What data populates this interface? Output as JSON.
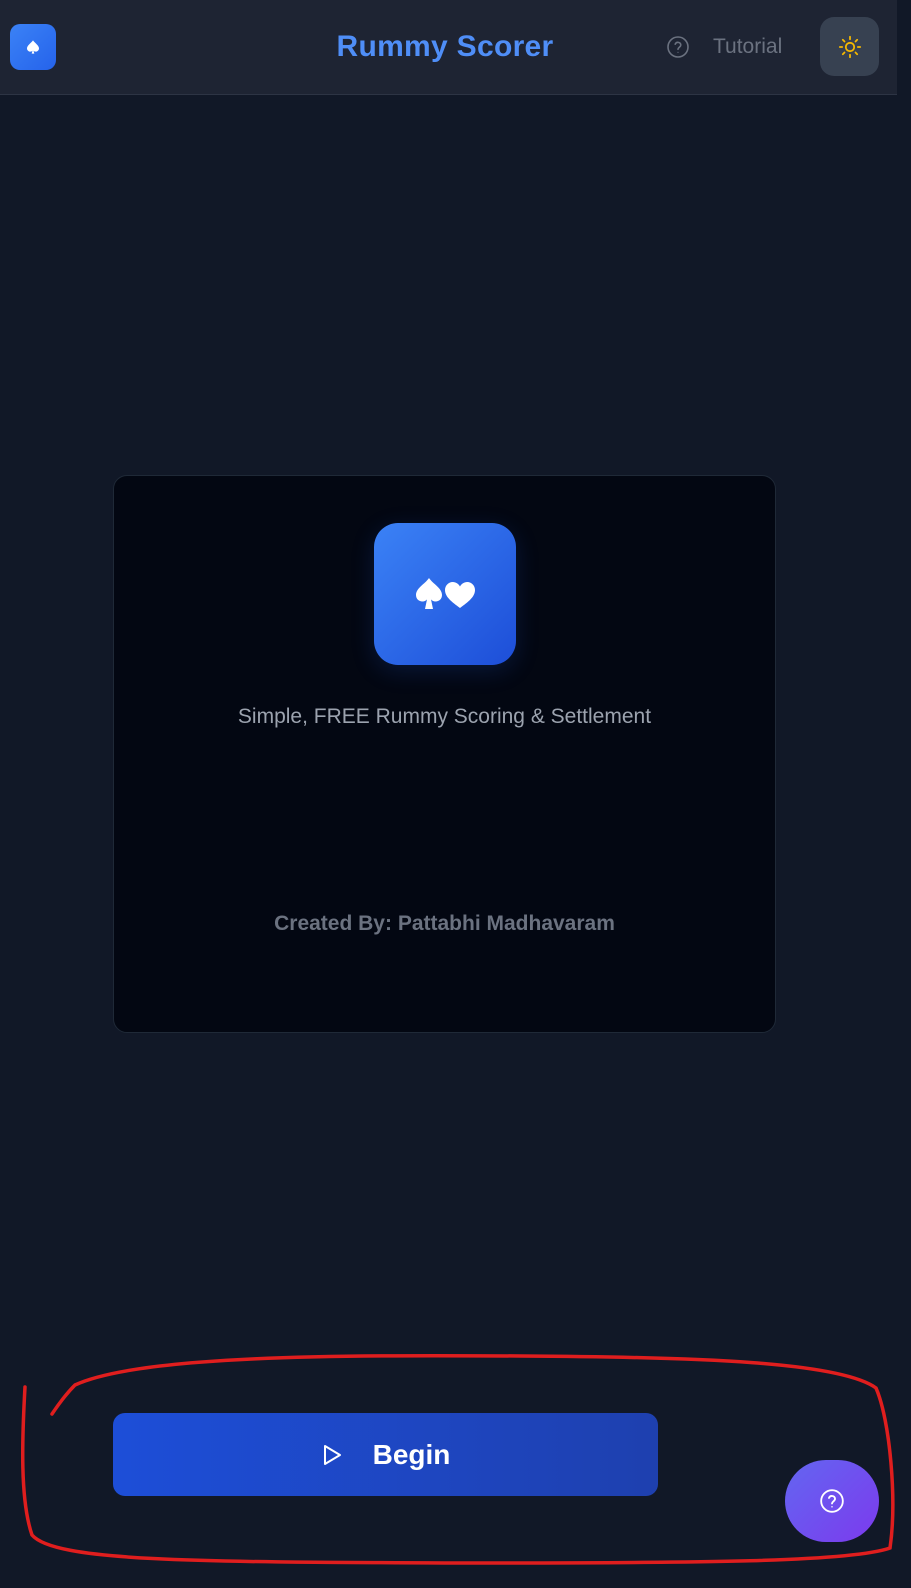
{
  "header": {
    "title": "Rummy Scorer",
    "tutorial_label": "Tutorial",
    "logo_icon": "spade-icon",
    "help_icon": "question-circle-icon",
    "theme_icon": "sun-icon"
  },
  "card": {
    "hero_icon": "spade-heart-icon",
    "tagline": "Simple, FREE Rummy Scoring & Settlement",
    "credit": "Created By: Pattabhi Madhavaram"
  },
  "actions": {
    "begin_label": "Begin",
    "begin_icon": "play-icon",
    "fab_icon": "question-circle-icon"
  },
  "colors": {
    "background": "#111827",
    "header": "#1e2433",
    "accent": "#4f8ef7",
    "primary_button": "#1d4ed8",
    "fab": "#7c3aed",
    "annotation": "#e01e1e"
  }
}
